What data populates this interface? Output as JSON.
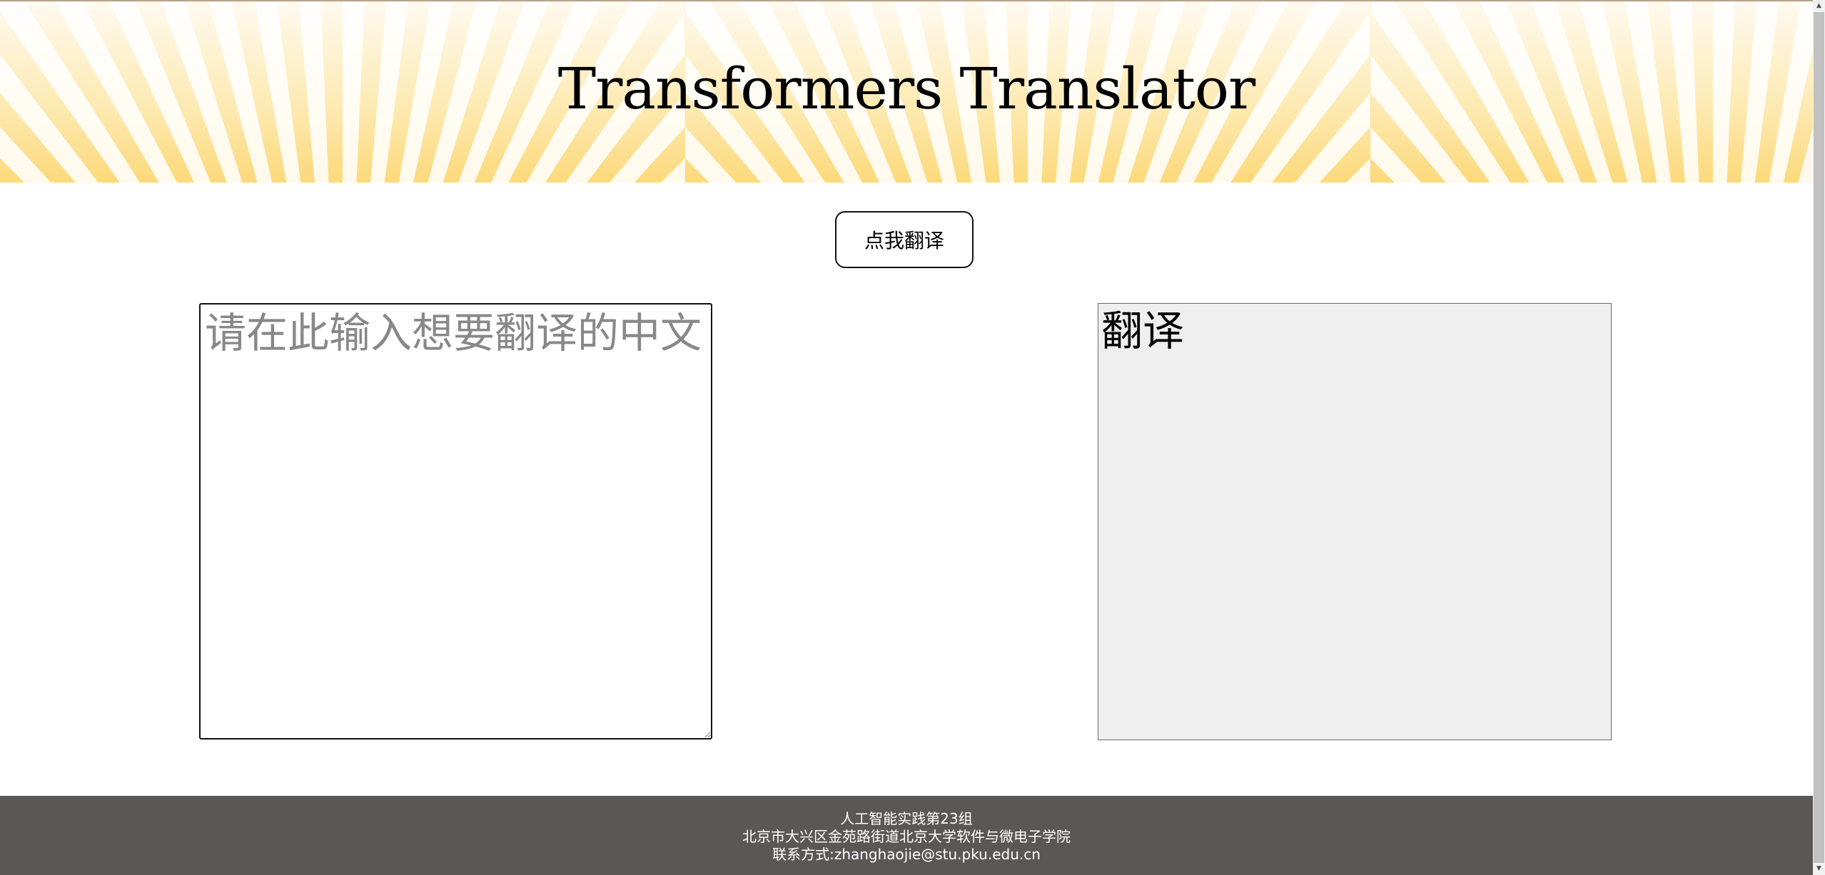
{
  "page": {
    "title": "Transformers Translator"
  },
  "toolbar": {
    "translate_label": "点我翻译"
  },
  "input": {
    "placeholder": "请在此输入想要翻译的中文",
    "value": ""
  },
  "output": {
    "value": "翻译"
  },
  "footer": {
    "line1": "人工智能实践第23组",
    "line2": "北京市大兴区金苑路街道北京大学软件与微电子学院",
    "line3": "联系方式:zhanghaojie@stu.pku.edu.cn"
  },
  "colors": {
    "header_ray": "#fcd879",
    "footer_bg": "#595855",
    "output_bg": "#efefef"
  },
  "icons": {
    "scroll_up": "triangle-up",
    "scroll_down": "triangle-down"
  }
}
